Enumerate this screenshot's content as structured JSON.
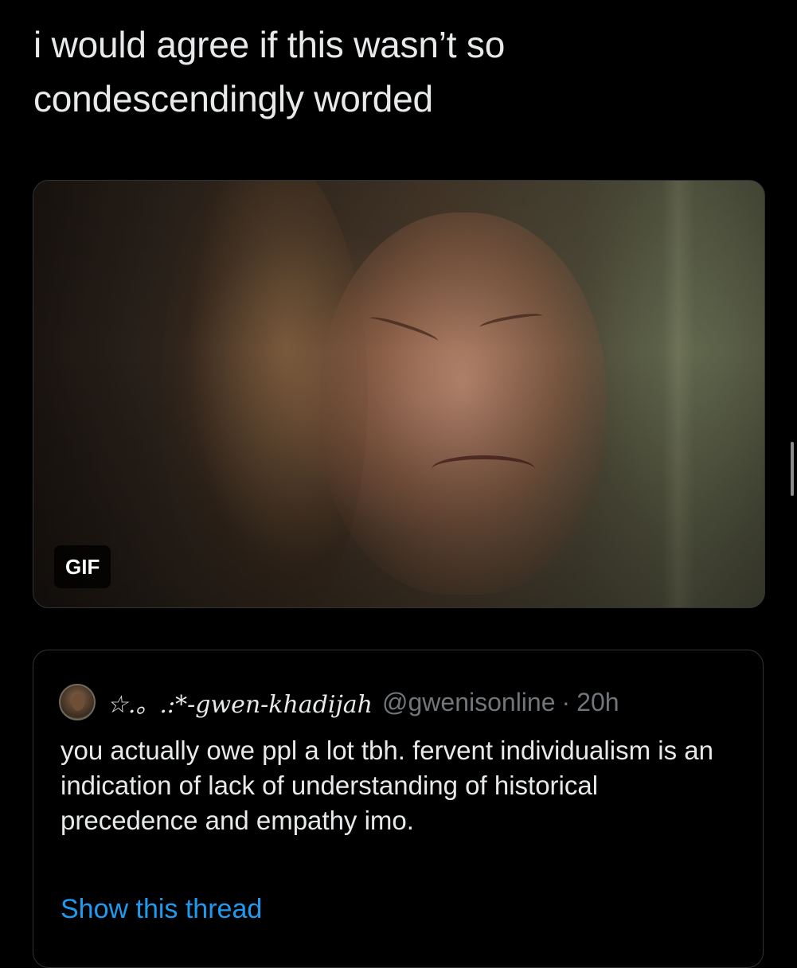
{
  "tweet": {
    "text_line1": "i would agree if this wasn’t so",
    "text_line2": "condescendingly worded",
    "media": {
      "badge": "GIF"
    }
  },
  "quoted_tweet": {
    "display_name": "☆.。.:*-gwen-khadijah",
    "handle": "@gwenisonline",
    "separator": "·",
    "time": "20h",
    "body": "you actually owe ppl a lot tbh. fervent individualism is an indication of lack of understanding of historical precedence and empathy imo.",
    "show_thread_label": "Show this thread"
  },
  "colors": {
    "background": "#000000",
    "text": "#e7e9ea",
    "secondary_text": "#71767b",
    "link": "#1d9bf0",
    "border": "#2f3336"
  }
}
